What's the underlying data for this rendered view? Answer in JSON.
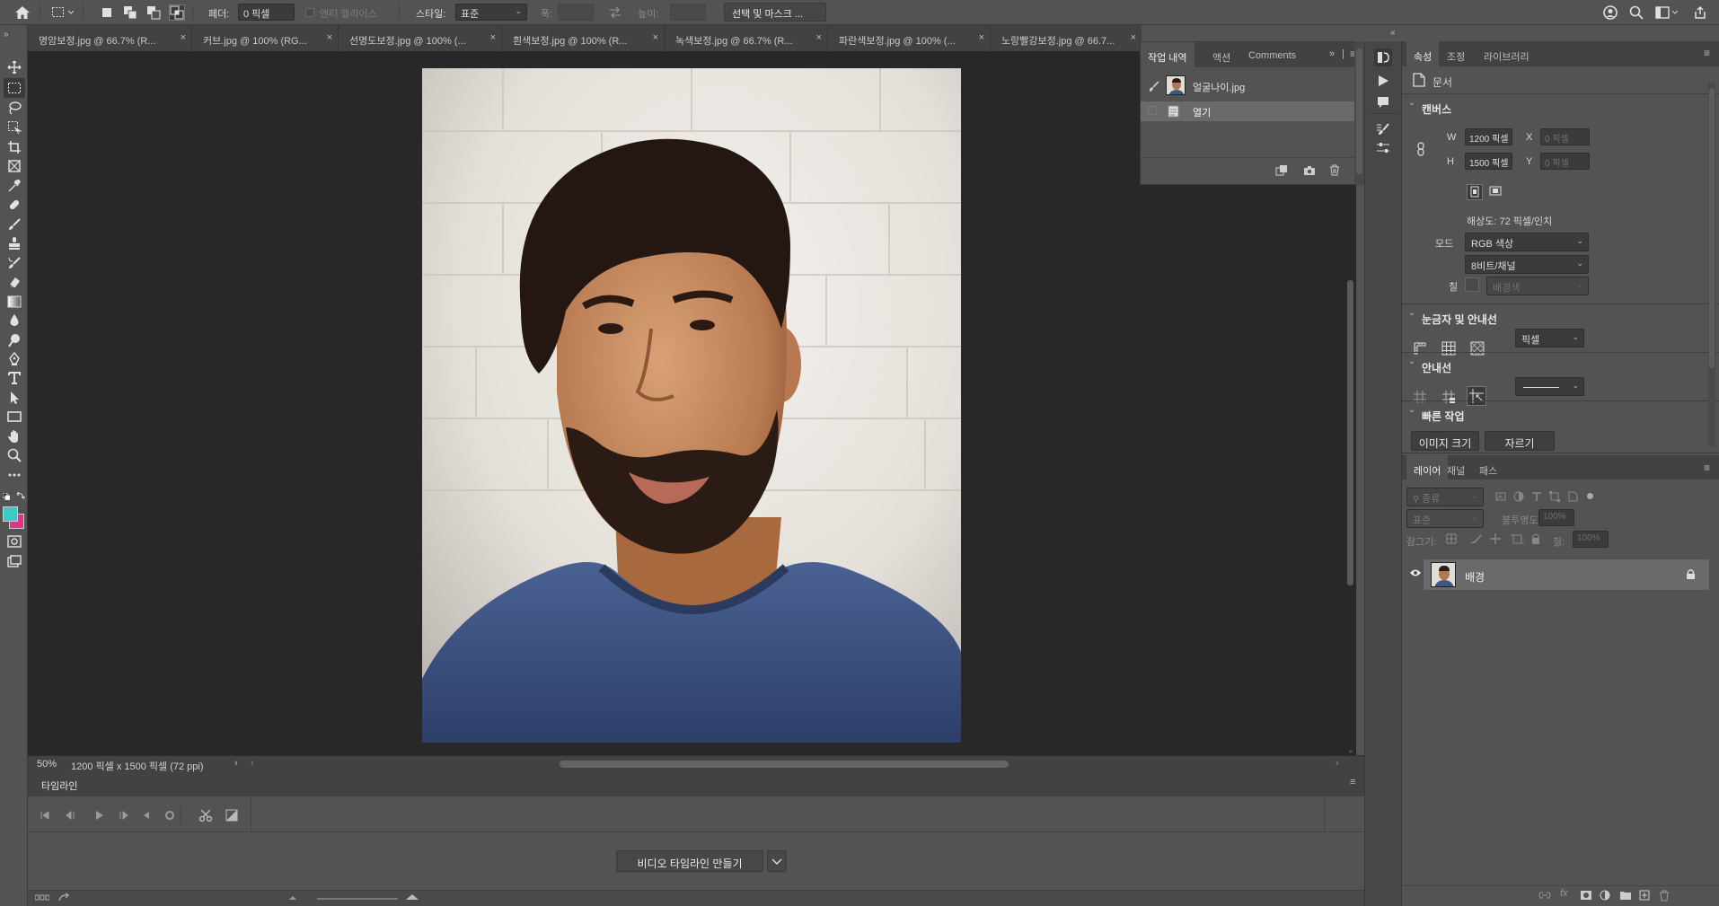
{
  "options_bar": {
    "feather_label": "페더:",
    "feather_value": "0 픽셀",
    "antialias_label": "앤티 앨리어스",
    "style_label": "스타일:",
    "style_value": "표준",
    "width_label": "폭:",
    "height_label": "높이:",
    "select_mask_button": "선택 및 마스크 ..."
  },
  "document_tabs": [
    {
      "label": "명암보정.jpg @ 66.7% (R...",
      "close": "×"
    },
    {
      "label": "커브.jpg @ 100% (RG...",
      "close": "×"
    },
    {
      "label": "선명도보정.jpg @ 100% (...",
      "close": "×"
    },
    {
      "label": "흰색보정.jpg @ 100% (R...",
      "close": "×"
    },
    {
      "label": "녹색보정.jpg @ 66.7% (R...",
      "close": "×"
    },
    {
      "label": "파란색보정.jpg @ 100% (...",
      "close": "×"
    },
    {
      "label": "노랑빨강보정.jpg @ 66.7...",
      "close": "×"
    }
  ],
  "status_bar": {
    "zoom": "50%",
    "doc_info": "1200 픽셀 x 1500 픽셀 (72 ppi)"
  },
  "timeline": {
    "tab_label": "타임라인",
    "create_button": "비디오 타임라인 만들기"
  },
  "history_panel": {
    "tabs": [
      "작업 내역",
      "액션",
      "Comments"
    ],
    "snapshot_name": "얼굴나이.jpg",
    "step_name": "열기"
  },
  "properties_panel": {
    "tabs": [
      "속성",
      "조정",
      "라이브러리"
    ],
    "doc_label": "문서",
    "canvas_header": "캔버스",
    "w_label": "W",
    "w_value": "1200 픽셀",
    "h_label": "H",
    "h_value": "1500 픽셀",
    "x_label": "X",
    "x_value": "0 픽셀",
    "y_label": "Y",
    "y_value": "0 픽셀",
    "resolution": "해상도: 72 픽셀/인치",
    "mode_label": "모드",
    "mode_value": "RGB 색상",
    "bit_value": "8비트/채널",
    "fill_label": "칠",
    "fill_value": "배경색",
    "rulers_header": "눈금자 및 안내선",
    "rulers_unit": "픽셀",
    "guides_header": "안내선",
    "quick_header": "빠른 작업",
    "image_size_button": "이미지 크기",
    "crop_button": "자르기"
  },
  "layers_panel": {
    "tabs": [
      "레이어",
      "채널",
      "패스"
    ],
    "filter_kind": "종류",
    "blend_mode": "표준",
    "opacity_label": "불투명도:",
    "opacity_value": "100%",
    "lock_label": "잠그기:",
    "fill_label": "칠:",
    "fill_value": "100%",
    "layer_name": "배경"
  },
  "colors": {
    "foreground": "#3ec9c4",
    "background": "#e0338a",
    "canvas_bg": "#282828",
    "panel_bg": "#535353"
  }
}
